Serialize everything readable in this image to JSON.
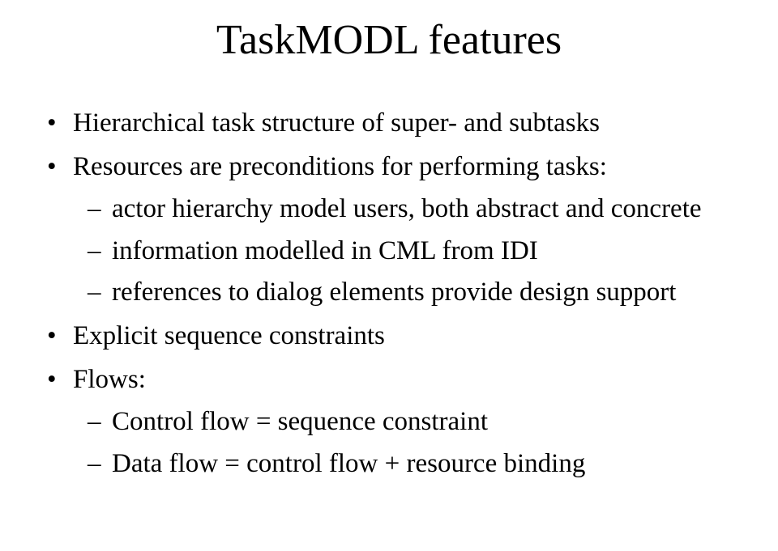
{
  "title": "TaskMODL features",
  "bullets": [
    {
      "text": "Hierarchical task structure of super- and subtasks",
      "sub": []
    },
    {
      "text": "Resources are preconditions for performing tasks:",
      "sub": [
        "actor hierarchy model users, both abstract and concrete",
        "information modelled in CML from IDI",
        "references to dialog elements provide design support"
      ]
    },
    {
      "text": "Explicit sequence constraints",
      "sub": []
    },
    {
      "text": "Flows:",
      "sub": [
        "Control flow = sequence constraint",
        "Data flow = control flow + resource binding"
      ]
    }
  ]
}
